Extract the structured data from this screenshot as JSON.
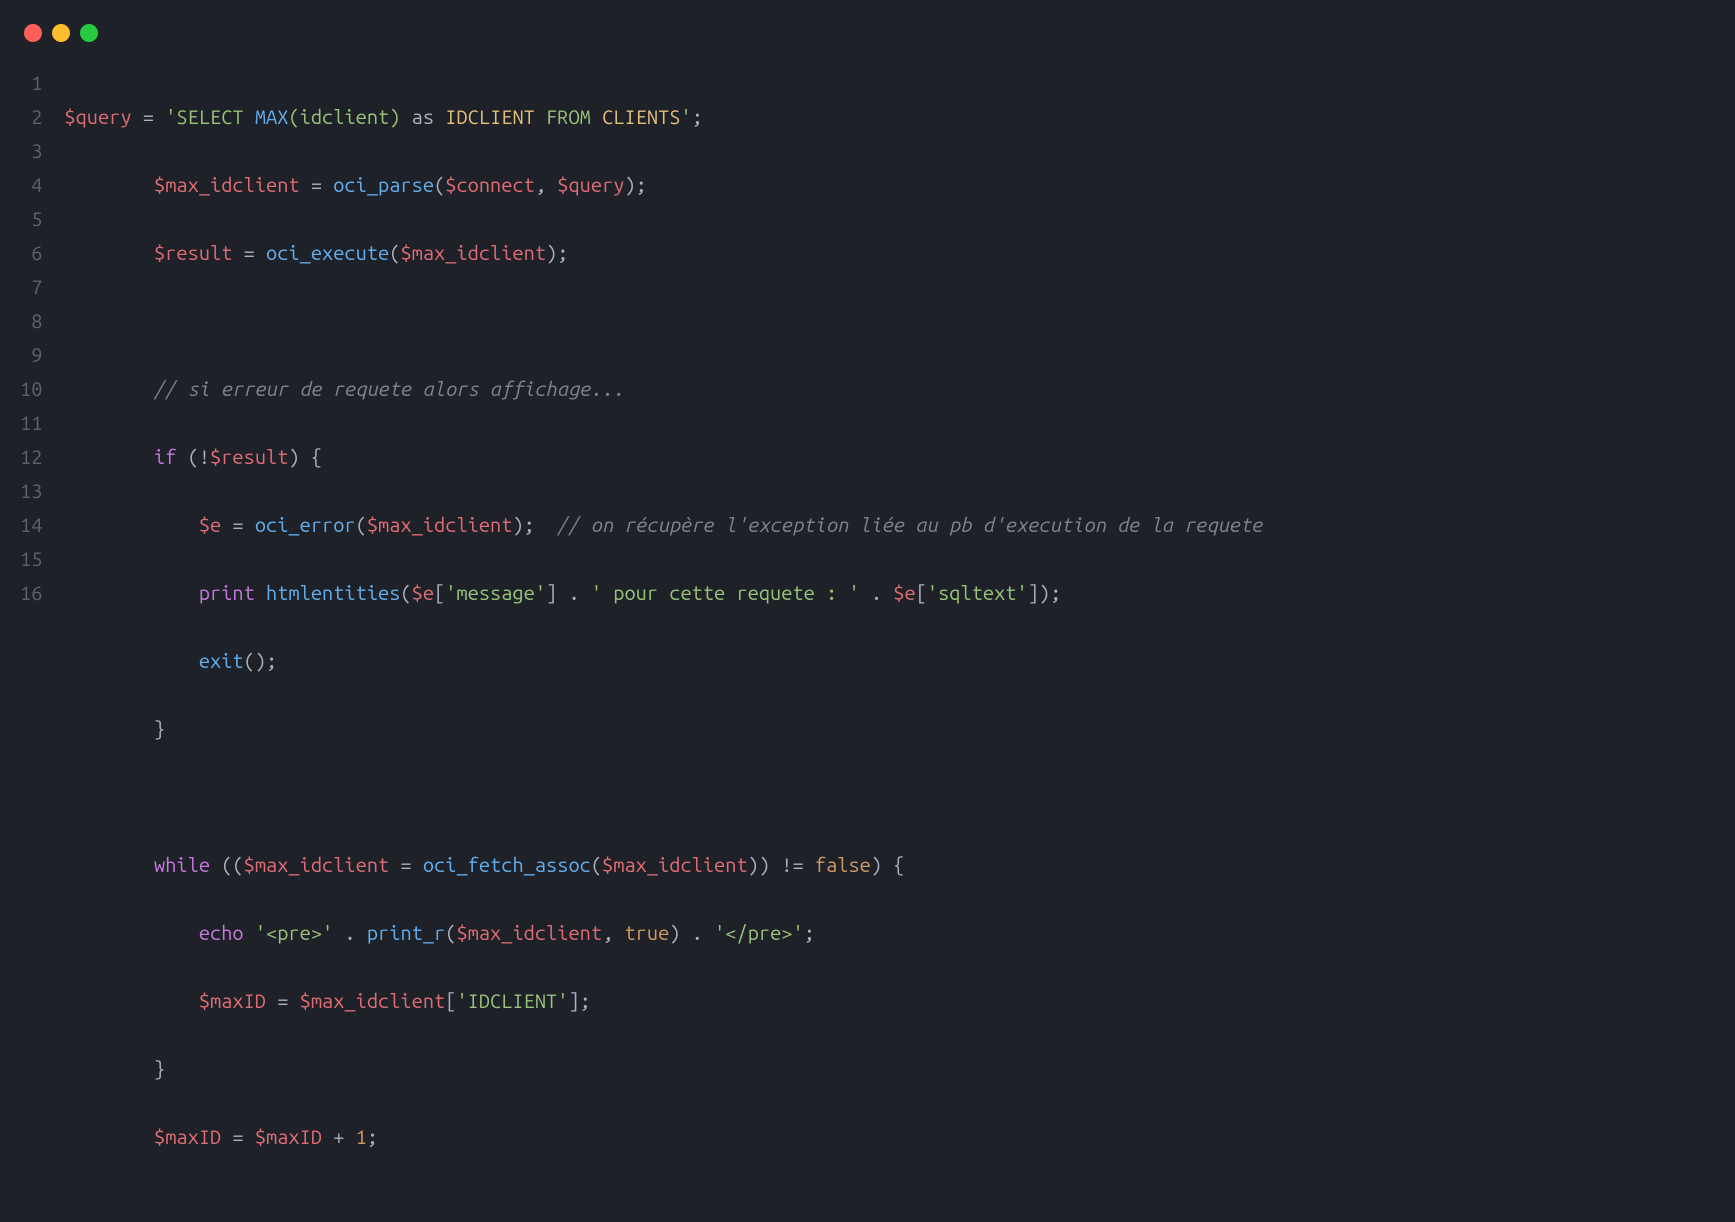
{
  "titlebar": {
    "close": "close",
    "min": "minimize",
    "max": "maximize"
  },
  "line_numbers": [
    "1",
    "2",
    "3",
    "4",
    "5",
    "6",
    "7",
    "8",
    "9",
    "10",
    "11",
    "12",
    "13",
    "14",
    "15",
    "16"
  ],
  "code": {
    "l1": {
      "var_query": "$query",
      "eq": " = ",
      "q_open": "'",
      "sql_select": "SELECT",
      "sp1": " ",
      "sql_max": "MAX",
      "sql_paren_open": "(",
      "sql_idclient": "idclient",
      "sql_paren_close": ")",
      "sp2": " ",
      "sql_as": "as",
      "sp3": " ",
      "sql_IDCLIENT": "IDCLIENT",
      "sp4": " ",
      "sql_from": "FROM",
      "sp5": " ",
      "sql_clients": "CLIENTS",
      "q_close": "'",
      "semi": ";"
    },
    "l2": {
      "indent": "        ",
      "var_max": "$max_idclient",
      "eq": " = ",
      "fn": "oci_parse",
      "open": "(",
      "arg1": "$connect",
      "comma": ", ",
      "arg2": "$query",
      "close": ")",
      "semi": ";"
    },
    "l3": {
      "indent": "        ",
      "var_result": "$result",
      "eq": " = ",
      "fn": "oci_execute",
      "open": "(",
      "arg": "$max_idclient",
      "close": ")",
      "semi": ";"
    },
    "l4": {
      "blank": ""
    },
    "l5": {
      "indent": "        ",
      "comment": "// si erreur de requete alors affichage..."
    },
    "l6": {
      "indent": "        ",
      "kw_if": "if",
      "open": " (",
      "bang": "!",
      "var_result": "$result",
      "close": ") ",
      "brace": "{"
    },
    "l7": {
      "indent": "            ",
      "var_e": "$e",
      "eq": " = ",
      "fn": "oci_error",
      "open": "(",
      "arg": "$max_idclient",
      "close": ")",
      "semi": ";  ",
      "comment": "// on récupère l'exception liée au pb d'execution de la requete"
    },
    "l8": {
      "indent": "            ",
      "kw_print": "print",
      "sp": " ",
      "fn": "htmlentities",
      "open": "(",
      "var_e1": "$e",
      "br_open1": "[",
      "key1": "'message'",
      "br_close1": "]",
      "dot1": " . ",
      "str": "' pour cette requete : '",
      "dot2": " . ",
      "var_e2": "$e",
      "br_open2": "[",
      "key2": "'sqltext'",
      "br_close2": "]",
      "close": ")",
      "semi": ";"
    },
    "l9": {
      "indent": "            ",
      "fn": "exit",
      "parens": "()",
      "semi": ";"
    },
    "l10": {
      "indent": "        ",
      "brace": "}"
    },
    "l11": {
      "blank": ""
    },
    "l12": {
      "indent": "        ",
      "kw_while": "while",
      "open": " ((",
      "var_max": "$max_idclient",
      "eq": " = ",
      "fn": "oci_fetch_assoc",
      "fopen": "(",
      "arg": "$max_idclient",
      "fclose": "))",
      "neq": " != ",
      "false": "false",
      "close": ") ",
      "brace": "{"
    },
    "l13": {
      "indent": "            ",
      "kw_echo": "echo",
      "sp": " ",
      "str1": "'<pre>'",
      "dot1": " . ",
      "fn": "print_r",
      "open": "(",
      "arg1": "$max_idclient",
      "comma": ", ",
      "true": "true",
      "close": ")",
      "dot2": " . ",
      "str2": "'</pre>'",
      "semi": ";"
    },
    "l14": {
      "indent": "            ",
      "var_maxID": "$maxID",
      "eq": " = ",
      "var_max": "$max_idclient",
      "br_open": "[",
      "key": "'IDCLIENT'",
      "br_close": "]",
      "semi": ";"
    },
    "l15": {
      "indent": "        ",
      "brace": "}"
    },
    "l16": {
      "indent": "        ",
      "var_maxID": "$maxID",
      "eq": " = ",
      "var_maxID2": "$maxID",
      "plus": " + ",
      "one": "1",
      "semi": ";"
    }
  }
}
